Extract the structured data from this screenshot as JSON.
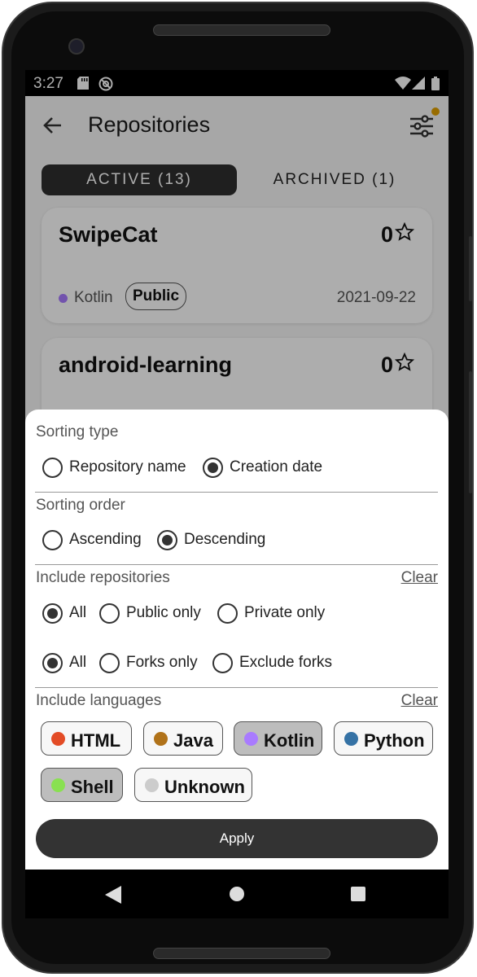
{
  "status_bar": {
    "time": "3:27"
  },
  "app_bar": {
    "title": "Repositories"
  },
  "tabs": [
    {
      "label": "ACTIVE (13)",
      "active": true
    },
    {
      "label": "ARCHIVED (1)",
      "active": false
    }
  ],
  "repositories": [
    {
      "name": "SwipeCat",
      "stars": "0",
      "language": "Kotlin",
      "language_color": "#a97bff",
      "visibility": "Public",
      "created": "2021-09-22"
    },
    {
      "name": "android-learning",
      "stars": "0"
    }
  ],
  "sheet": {
    "sorting_type": {
      "title": "Sorting type",
      "options": [
        {
          "label": "Repository name",
          "checked": false
        },
        {
          "label": "Creation date",
          "checked": true
        }
      ]
    },
    "sorting_order": {
      "title": "Sorting order",
      "options": [
        {
          "label": "Ascending",
          "checked": false
        },
        {
          "label": "Descending",
          "checked": true
        }
      ]
    },
    "include_repositories": {
      "title": "Include repositories",
      "clear_label": "Clear",
      "visibility_options": [
        {
          "label": "All",
          "checked": true
        },
        {
          "label": "Public only",
          "checked": false
        },
        {
          "label": "Private only",
          "checked": false
        }
      ],
      "fork_options": [
        {
          "label": "All",
          "checked": true
        },
        {
          "label": "Forks only",
          "checked": false
        },
        {
          "label": "Exclude forks",
          "checked": false
        }
      ]
    },
    "include_languages": {
      "title": "Include languages",
      "clear_label": "Clear",
      "chips": [
        {
          "label": "HTML",
          "color": "#e34c26",
          "selected": false
        },
        {
          "label": "Java",
          "color": "#b07219",
          "selected": false
        },
        {
          "label": "Kotlin",
          "color": "#a97bff",
          "selected": true
        },
        {
          "label": "Python",
          "color": "#3572a5",
          "selected": false
        },
        {
          "label": "Shell",
          "color": "#89e051",
          "selected": true
        },
        {
          "label": "Unknown",
          "color": "#cccccc",
          "selected": false
        }
      ]
    },
    "apply_label": "Apply"
  }
}
